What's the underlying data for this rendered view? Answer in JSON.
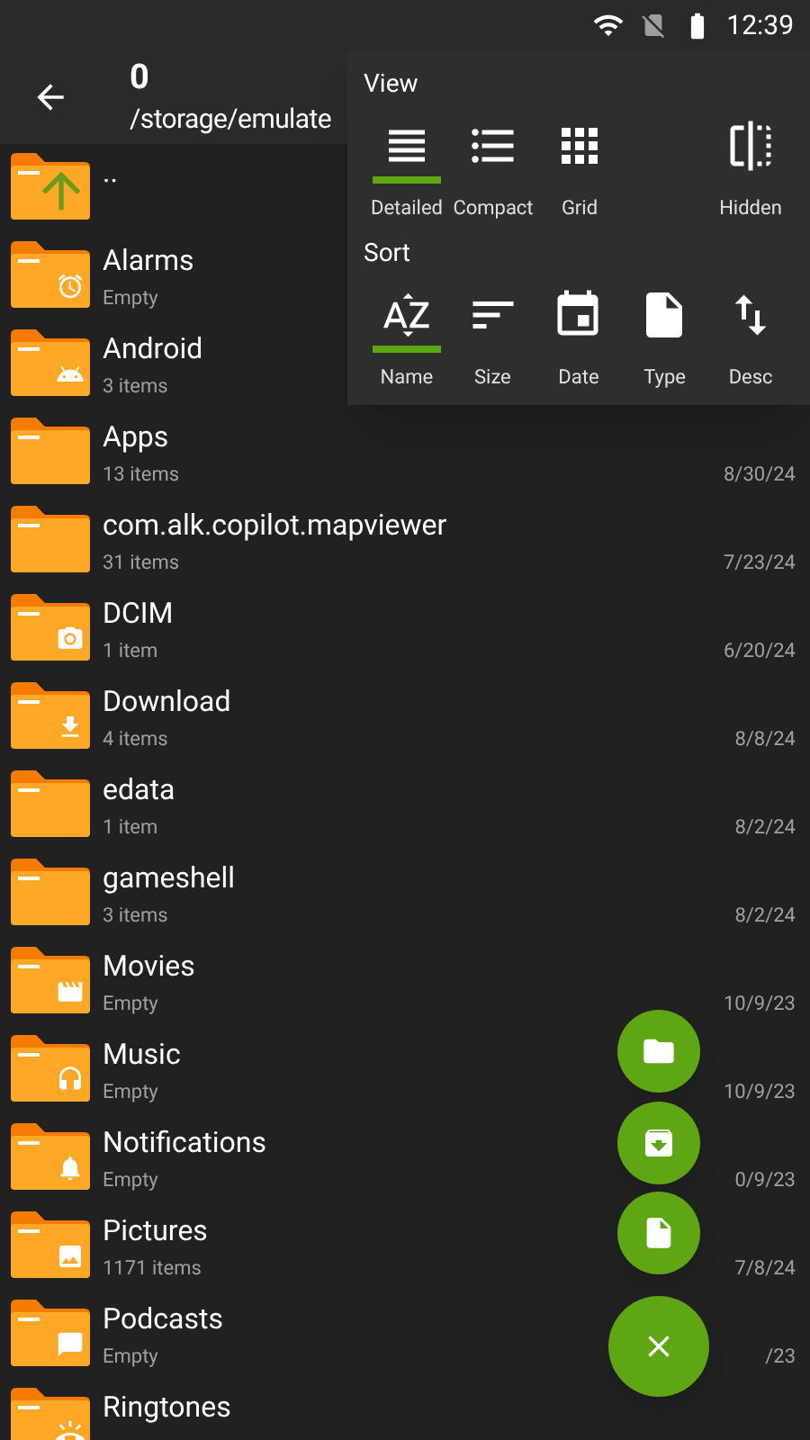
{
  "status_bar": {
    "time": "12:39"
  },
  "toolbar": {
    "title": "0",
    "path": "/storage/emulate"
  },
  "files": [
    {
      "name": "..",
      "kind": "parent"
    },
    {
      "name": "Alarms",
      "kind": "alarm",
      "info": "Empty"
    },
    {
      "name": "Android",
      "kind": "android",
      "info": "3 items"
    },
    {
      "name": "Apps",
      "kind": "plain",
      "info": "13 items",
      "date": "8/30/24"
    },
    {
      "name": "com.alk.copilot.mapviewer",
      "kind": "plain",
      "info": "31 items",
      "date": "7/23/24"
    },
    {
      "name": "DCIM",
      "kind": "camera",
      "info": "1 item",
      "date": "6/20/24"
    },
    {
      "name": "Download",
      "kind": "download",
      "info": "4 items",
      "date": "8/8/24"
    },
    {
      "name": "edata",
      "kind": "plain",
      "info": "1 item",
      "date": "8/2/24"
    },
    {
      "name": "gameshell",
      "kind": "plain",
      "info": "3 items",
      "date": "8/2/24"
    },
    {
      "name": "Movies",
      "kind": "movie",
      "info": "Empty",
      "date": "10/9/23"
    },
    {
      "name": "Music",
      "kind": "music",
      "info": "Empty",
      "date": "10/9/23"
    },
    {
      "name": "Notifications",
      "kind": "bell",
      "info": "Empty",
      "date": "0/9/23"
    },
    {
      "name": "Pictures",
      "kind": "image",
      "info": "1171 items",
      "date": "7/8/24"
    },
    {
      "name": "Podcasts",
      "kind": "chat",
      "info": "Empty",
      "date": "/23"
    },
    {
      "name": "Ringtones",
      "kind": "ringtone"
    }
  ],
  "menu": {
    "view_title": "View",
    "view_options": [
      {
        "label": "Detailed",
        "kind": "detailed",
        "selected": true
      },
      {
        "label": "Compact",
        "kind": "compact",
        "selected": false
      },
      {
        "label": "Grid",
        "kind": "grid",
        "selected": false
      },
      {
        "label": "Hidden",
        "kind": "hidden",
        "selected": false
      }
    ],
    "sort_title": "Sort",
    "sort_options": [
      {
        "label": "Name",
        "kind": "name",
        "selected": true
      },
      {
        "label": "Size",
        "kind": "size",
        "selected": false
      },
      {
        "label": "Date",
        "kind": "date",
        "selected": false
      },
      {
        "label": "Type",
        "kind": "type",
        "selected": false
      },
      {
        "label": "Desc",
        "kind": "desc",
        "selected": false
      }
    ]
  },
  "fabs": [
    {
      "kind": "folder"
    },
    {
      "kind": "archive"
    },
    {
      "kind": "file"
    },
    {
      "kind": "close"
    }
  ]
}
